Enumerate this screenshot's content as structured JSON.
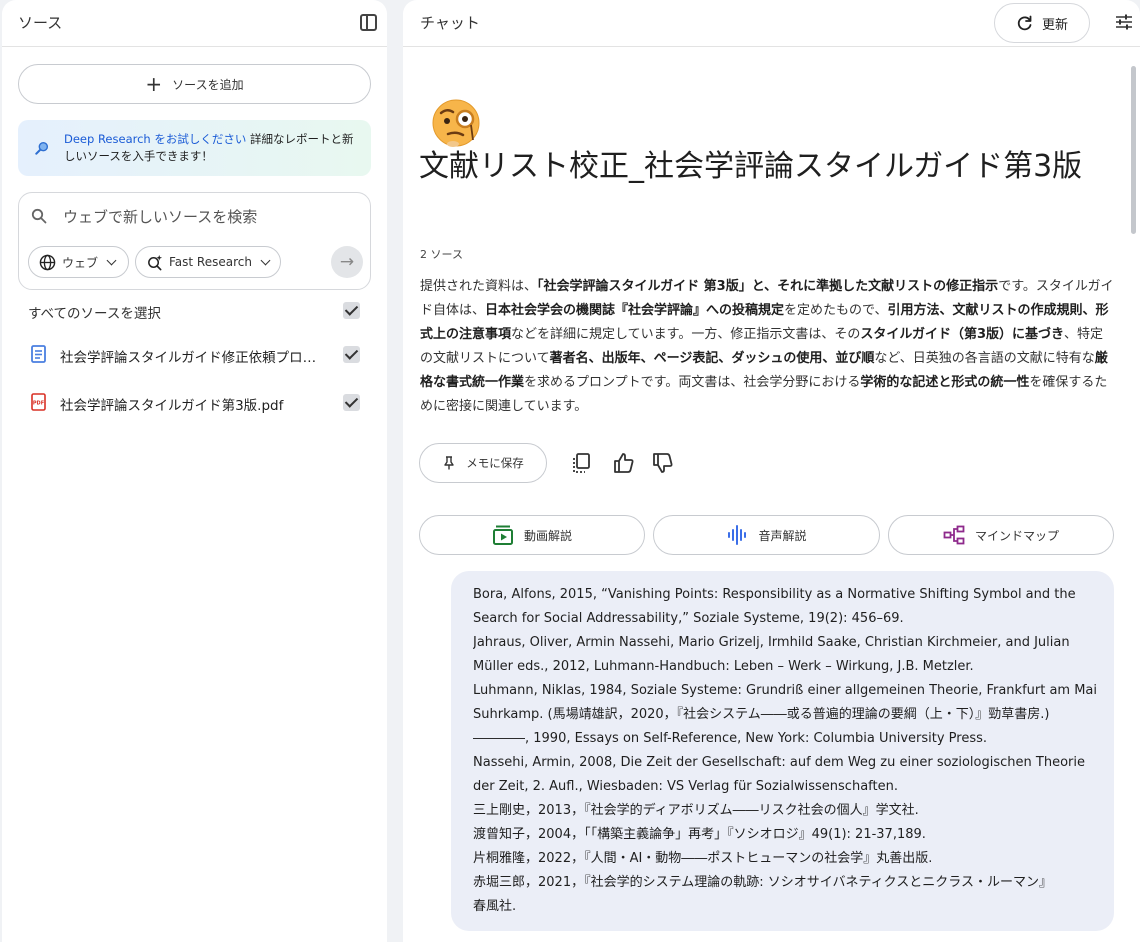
{
  "sources_panel": {
    "title": "ソース",
    "add_source_label": "ソースを追加",
    "deep_research": {
      "link_text": "Deep Research をお試しください",
      "text": " 詳細なレポートと新しいソースを入手できます！"
    },
    "search": {
      "placeholder": "ウェブで新しいソースを検索",
      "web_option": "ウェブ",
      "research_option": "Fast Research"
    },
    "select_all_label": "すべてのソースを選択",
    "items": [
      {
        "label": "社会学評論スタイルガイド修正依頼プロンプト",
        "type": "doc",
        "checked": true
      },
      {
        "label": "社会学評論スタイルガイド第3版.pdf",
        "type": "pdf",
        "checked": true
      }
    ],
    "colors": {
      "doc_icon": "#4a7fe0",
      "pdf_icon": "#d93025"
    }
  },
  "chat_panel": {
    "title": "チャット",
    "refresh_label": "更新",
    "notebook_title": "文献リスト校正_社会学評論スタイルガイド第3版",
    "source_count": "2 ソース",
    "summary_parts": [
      {
        "text": "提供された資料は、",
        "bold": false
      },
      {
        "text": "「社会学評論スタイルガイド 第3版」と、それに準拠した文献リストの修正指示",
        "bold": true
      },
      {
        "text": "です。スタイルガイド自体は、",
        "bold": false
      },
      {
        "text": "日本社会学会の機関誌『社会学評論』への投稿規定",
        "bold": true
      },
      {
        "text": "を定めたもので、",
        "bold": false
      },
      {
        "text": "引用方法、文献リストの作成規則、形式上の注意事項",
        "bold": true
      },
      {
        "text": "などを詳細に規定しています。一方、修正指示文書は、その",
        "bold": false
      },
      {
        "text": "スタイルガイド（第3版）に基づき",
        "bold": true
      },
      {
        "text": "、特定の文献リストについて",
        "bold": false
      },
      {
        "text": "著者名、出版年、ページ表記、ダッシュの使用、並び順",
        "bold": true
      },
      {
        "text": "など、日英独の各言語の文献に特有な",
        "bold": false
      },
      {
        "text": "厳格な書式統一作業",
        "bold": true
      },
      {
        "text": "を求めるプロンプトです。両文書は、社会学分野における",
        "bold": false
      },
      {
        "text": "学術的な記述と形式の統一性",
        "bold": true
      },
      {
        "text": "を確保するために密接に関連しています。",
        "bold": false
      }
    ],
    "memo_label": "メモに保存",
    "studio": {
      "video_label": "動画解説",
      "audio_label": "音声解説",
      "mindmap_label": "マインドマップ"
    },
    "colors": {
      "video_icon": "#1e7e34",
      "audio_icon": "#3b6ee8",
      "mindmap_icon": "#8e2a8c"
    },
    "message_lines": [
      "Bora, Alfons, 2015, “Vanishing Points: Responsibility as a Normative Shifting Symbol and the",
      "Search for Social Addressability,” Soziale Systeme, 19(2): 456–69.",
      "Jahraus, Oliver, Armin Nassehi, Mario Grizelj, Irmhild Saake, Christian Kirchmeier, and Julian",
      "Müller eds., 2012, Luhmann-Handbuch: Leben – Werk – Wirkung, J.B. Metzler.",
      "Luhmann, Niklas, 1984, Soziale Systeme: Grundriß einer allgemeinen Theorie, Frankfurt am Main:",
      "Suhrkamp. (馬場靖雄訳，2020，『社会システム――或る普遍的理論の要綱（上・下）』勁草書房.)",
      "――――, 1990, Essays on Self-Reference, New York: Columbia University Press.",
      "Nassehi, Armin, 2008, Die Zeit der Gesellschaft: auf dem Weg zu einer soziologischen Theorie",
      "der Zeit, 2. Aufl., Wiesbaden: VS Verlag für Sozialwissenschaften.",
      "三上剛史，2013，『社会学的ディアボリズム――リスク社会の個人』学文社.",
      "渡曾知子，2004，「「構築主義論争」再考」『ソシオロジ』49(1): 21-37,189.",
      "片桐雅隆，2022，『人間・AI・動物――ポストヒューマンの社会学』丸善出版.",
      "赤堀三郎，2021，『社会学的システム理論の軌跡: ソシオサイバネティクスとニクラス・ルーマン』",
      "春風社."
    ]
  }
}
